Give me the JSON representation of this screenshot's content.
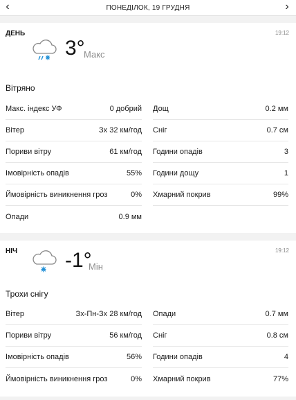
{
  "header": {
    "date": "ПОНЕДІЛОК, 19 ГРУДНЯ",
    "prev": "‹",
    "next": "›"
  },
  "day": {
    "period": "ДЕНЬ",
    "time": "19:12",
    "icon": "cloud-rain-snow-icon",
    "temp": "3°",
    "temp_label": "Макс",
    "condition": "Вітряно",
    "left": [
      {
        "label": "Макс. індекс УФ",
        "value": "0 добрий"
      },
      {
        "label": "Вітер",
        "value": "Зх 32 км/год"
      },
      {
        "label": "Пориви вітру",
        "value": "61 км/год"
      },
      {
        "label": "Імовірність опадів",
        "value": "55%"
      },
      {
        "label": "Ймовірність виникнення гроз",
        "value": "0%"
      },
      {
        "label": "Опади",
        "value": "0.9 мм"
      }
    ],
    "right": [
      {
        "label": "Дощ",
        "value": "0.2 мм"
      },
      {
        "label": "Сніг",
        "value": "0.7 см"
      },
      {
        "label": "Години опадів",
        "value": "3"
      },
      {
        "label": "Години дощу",
        "value": "1"
      },
      {
        "label": "Хмарний покрив",
        "value": "99%"
      }
    ]
  },
  "night": {
    "period": "НІЧ",
    "time": "19:12",
    "icon": "cloud-snow-icon",
    "temp": "-1°",
    "temp_label": "Мін",
    "condition": "Трохи снігу",
    "left": [
      {
        "label": "Вітер",
        "value": "Зх-Пн-Зх 28 км/год"
      },
      {
        "label": "Пориви вітру",
        "value": "56 км/год"
      },
      {
        "label": "Імовірність опадів",
        "value": "56%"
      },
      {
        "label": "Ймовірність виникнення гроз",
        "value": "0%"
      }
    ],
    "right": [
      {
        "label": "Опади",
        "value": "0.7 мм"
      },
      {
        "label": "Сніг",
        "value": "0.8 см"
      },
      {
        "label": "Години опадів",
        "value": "4"
      },
      {
        "label": "Хмарний покрив",
        "value": "77%"
      }
    ]
  },
  "colors": {
    "background": "#f2f2f2",
    "card": "#ffffff",
    "divider": "#e6e6e6",
    "icon_blue": "#1f8fd6",
    "muted": "#8c8c8c"
  }
}
